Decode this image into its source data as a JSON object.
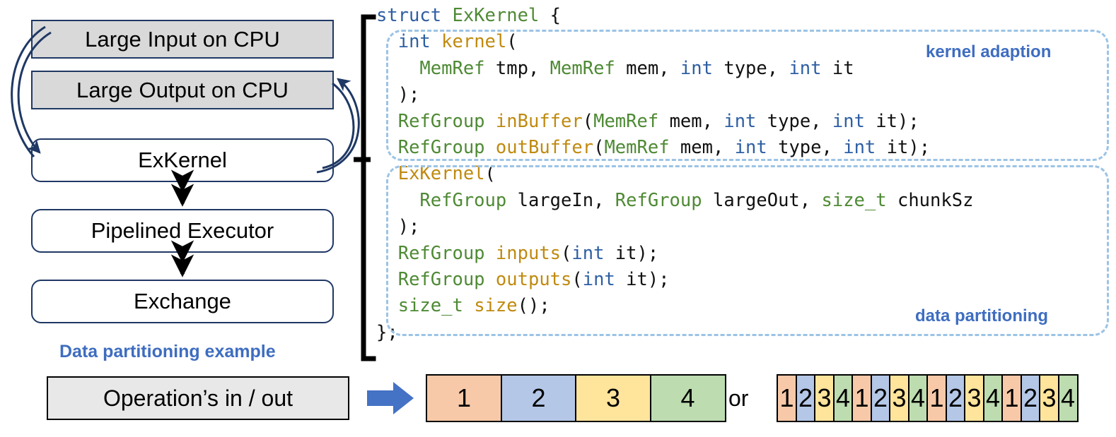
{
  "diagram": {
    "boxes": [
      {
        "label": "Large Input on CPU",
        "style": "filled"
      },
      {
        "label": "Large Output on CPU",
        "style": "filled"
      },
      {
        "label": "ExKernel",
        "style": "rounded"
      },
      {
        "label": "Pipelined Executor",
        "style": "rounded"
      },
      {
        "label": "Exchange",
        "style": "rounded"
      }
    ],
    "caption": "Data partitioning example",
    "colors": {
      "box_border": "#1F3864",
      "filled_fill": "#D9D9D9",
      "arrow": "#1F3864",
      "accent_blue": "#3E6DC0"
    }
  },
  "code": {
    "lines": [
      [
        {
          "t": "struct ",
          "c": "kw"
        },
        {
          "t": "ExKernel",
          "c": "ty"
        },
        {
          "t": " {",
          "c": "pl"
        }
      ],
      [
        {
          "t": "  ",
          "c": "pl"
        },
        {
          "t": "int ",
          "c": "kw"
        },
        {
          "t": "kernel",
          "c": "fn"
        },
        {
          "t": "(",
          "c": "pl"
        }
      ],
      [
        {
          "t": "    ",
          "c": "pl"
        },
        {
          "t": "MemRef",
          "c": "ty"
        },
        {
          "t": " tmp, ",
          "c": "pl"
        },
        {
          "t": "MemRef",
          "c": "ty"
        },
        {
          "t": " mem, ",
          "c": "pl"
        },
        {
          "t": "int",
          "c": "kw"
        },
        {
          "t": " type, ",
          "c": "pl"
        },
        {
          "t": "int",
          "c": "kw"
        },
        {
          "t": " it",
          "c": "pl"
        }
      ],
      [
        {
          "t": "  );",
          "c": "pl"
        }
      ],
      [
        {
          "t": "  ",
          "c": "pl"
        },
        {
          "t": "RefGroup",
          "c": "ty"
        },
        {
          "t": " ",
          "c": "pl"
        },
        {
          "t": "inBuffer",
          "c": "fn"
        },
        {
          "t": "(",
          "c": "pl"
        },
        {
          "t": "MemRef",
          "c": "ty"
        },
        {
          "t": " mem, ",
          "c": "pl"
        },
        {
          "t": "int",
          "c": "kw"
        },
        {
          "t": " type, ",
          "c": "pl"
        },
        {
          "t": "int",
          "c": "kw"
        },
        {
          "t": " it);",
          "c": "pl"
        }
      ],
      [
        {
          "t": "  ",
          "c": "pl"
        },
        {
          "t": "RefGroup",
          "c": "ty"
        },
        {
          "t": " ",
          "c": "pl"
        },
        {
          "t": "outBuffer",
          "c": "fn"
        },
        {
          "t": "(",
          "c": "pl"
        },
        {
          "t": "MemRef",
          "c": "ty"
        },
        {
          "t": " mem, ",
          "c": "pl"
        },
        {
          "t": "int",
          "c": "kw"
        },
        {
          "t": " type, ",
          "c": "pl"
        },
        {
          "t": "int",
          "c": "kw"
        },
        {
          "t": " it);",
          "c": "pl"
        }
      ],
      [
        {
          "t": "  ",
          "c": "pl"
        },
        {
          "t": "ExKernel",
          "c": "fn"
        },
        {
          "t": "(",
          "c": "pl"
        }
      ],
      [
        {
          "t": "    ",
          "c": "pl"
        },
        {
          "t": "RefGroup",
          "c": "ty"
        },
        {
          "t": " largeIn, ",
          "c": "pl"
        },
        {
          "t": "RefGroup",
          "c": "ty"
        },
        {
          "t": " largeOut, ",
          "c": "pl"
        },
        {
          "t": "size_t",
          "c": "ty"
        },
        {
          "t": " chunkSz",
          "c": "pl"
        }
      ],
      [
        {
          "t": "  );",
          "c": "pl"
        }
      ],
      [
        {
          "t": "  ",
          "c": "pl"
        },
        {
          "t": "RefGroup",
          "c": "ty"
        },
        {
          "t": " ",
          "c": "pl"
        },
        {
          "t": "inputs",
          "c": "fn"
        },
        {
          "t": "(",
          "c": "pl"
        },
        {
          "t": "int",
          "c": "kw"
        },
        {
          "t": " it);",
          "c": "pl"
        }
      ],
      [
        {
          "t": "  ",
          "c": "pl"
        },
        {
          "t": "RefGroup",
          "c": "ty"
        },
        {
          "t": " ",
          "c": "pl"
        },
        {
          "t": "outputs",
          "c": "fn"
        },
        {
          "t": "(",
          "c": "pl"
        },
        {
          "t": "int",
          "c": "kw"
        },
        {
          "t": " it);",
          "c": "pl"
        }
      ],
      [
        {
          "t": "  ",
          "c": "pl"
        },
        {
          "t": "size_t",
          "c": "ty"
        },
        {
          "t": " ",
          "c": "pl"
        },
        {
          "t": "size",
          "c": "fn"
        },
        {
          "t": "();",
          "c": "pl"
        }
      ],
      [
        {
          "t": "};",
          "c": "pl"
        }
      ]
    ],
    "annotations": {
      "kernel_adaption": "kernel adaption",
      "data_partitioning": "data partitioning"
    },
    "colors": {
      "keyword": "#2E5FA3",
      "type": "#4E8A34",
      "function": "#C08A10",
      "plain": "#111111",
      "dashed_border": "#9CC3E5"
    }
  },
  "partition": {
    "source_label": "Operation’s in / out",
    "or_label": "or",
    "coarse": {
      "labels": [
        "1",
        "2",
        "3",
        "4"
      ],
      "colors": [
        "#F7C9A8",
        "#B4C7E7",
        "#FFE49C",
        "#BDDCB0"
      ]
    },
    "fine": {
      "labels": [
        "1",
        "2",
        "3",
        "4",
        "1",
        "2",
        "3",
        "4",
        "1",
        "2",
        "3",
        "4",
        "1",
        "2",
        "3",
        "4"
      ],
      "colors": [
        "#F7C9A8",
        "#B4C7E7",
        "#FFE49C",
        "#BDDCB0",
        "#F7C9A8",
        "#B4C7E7",
        "#FFE49C",
        "#BDDCB0",
        "#F7C9A8",
        "#B4C7E7",
        "#FFE49C",
        "#BDDCB0",
        "#F7C9A8",
        "#B4C7E7",
        "#FFE49C",
        "#BDDCB0"
      ]
    },
    "arrow_color": "#4472C4"
  }
}
